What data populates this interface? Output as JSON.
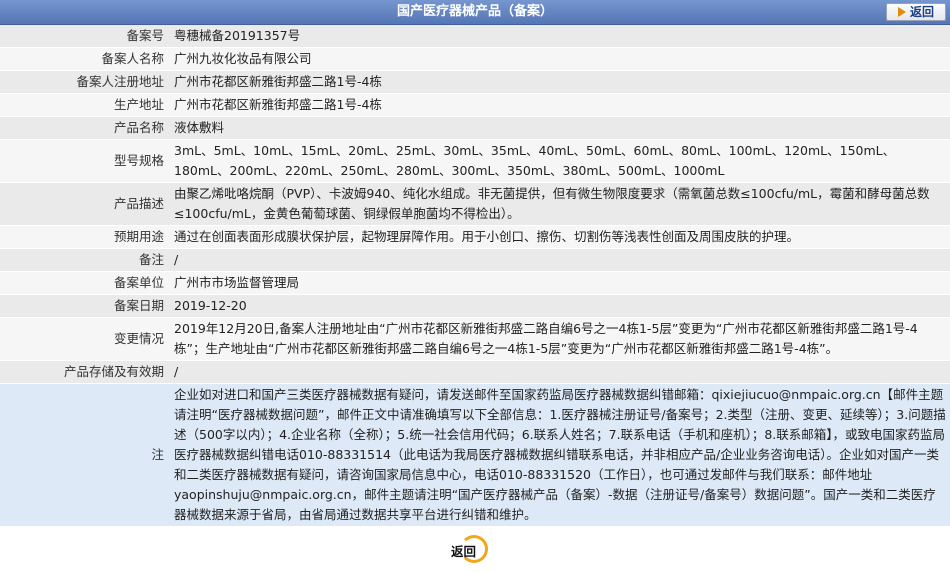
{
  "header": {
    "title": "国产医疗器械产品（备案）",
    "back_label": "返回"
  },
  "rows": [
    {
      "label": "备案号",
      "value": "粤穗械备20191357号"
    },
    {
      "label": "备案人名称",
      "value": "广州九妆化妆品有限公司"
    },
    {
      "label": "备案人注册地址",
      "value": "广州市花都区新雅街邦盛二路1号-4栋"
    },
    {
      "label": "生产地址",
      "value": "广州市花都区新雅街邦盛二路1号-4栋"
    },
    {
      "label": "产品名称",
      "value": "液体敷料"
    },
    {
      "label": "型号规格",
      "value": "3mL、5mL、10mL、15mL、20mL、25mL、30mL、35mL、40mL、50mL、60mL、80mL、100mL、120mL、150mL、180mL、200mL、220mL、250mL、280mL、300mL、350mL、380mL、500mL、1000mL"
    },
    {
      "label": "产品描述",
      "value": "由聚乙烯吡咯烷酮（PVP）、卡波姆940、纯化水组成。非无菌提供，但有微生物限度要求（需氧菌总数≤100cfu/mL，霉菌和酵母菌总数≤100cfu/mL，金黄色葡萄球菌、铜绿假单胞菌均不得检出）。"
    },
    {
      "label": "预期用途",
      "value": "通过在创面表面形成膜状保护层，起物理屏障作用。用于小创口、擦伤、切割伤等浅表性创面及周围皮肤的护理。"
    },
    {
      "label": "备注",
      "value": "/"
    },
    {
      "label": "备案单位",
      "value": "广州市市场监督管理局"
    },
    {
      "label": "备案日期",
      "value": "2019-12-20"
    },
    {
      "label": "变更情况",
      "value": "2019年12月20日,备案人注册地址由“广州市花都区新雅街邦盛二路自编6号之一4栋1-5层”变更为“广州市花都区新雅街邦盛二路1号-4栋”；生产地址由“广州市花都区新雅街邦盛二路自编6号之一4栋1-5层”变更为“广州市花都区新雅街邦盛二路1号-4栋”。"
    },
    {
      "label": "产品存储及有效期",
      "value": "/"
    }
  ],
  "note": {
    "label": "注",
    "text": "企业如对进口和国产三类医疗器械数据有疑问，请发送邮件至国家药监局医疗器械数据纠错邮箱：qixiejiucuo@nmpaic.org.cn【邮件主题请注明“医疗器械数据问题”，邮件正文中请准确填写以下全部信息：1.医疗器械注册证号/备案号；2.类型（注册、变更、延续等）；3.问题描述（500字以内）；4.企业名称（全称）；5.统一社会信用代码；6.联系人姓名；7.联系电话（手机和座机）；8.联系邮箱】，或致电国家药监局医疗器械数据纠错电话010-88331514（此电话为我局医疗器械数据纠错联系电话，并非相应产品/企业业务咨询电话）。企业如对国产一类和二类医疗器械数据有疑问，请咨询国家局信息中心，电话010-88331520（工作日），也可通过发邮件与我们联系：邮件地址yaopinshuju@nmpaic.org.cn，邮件主题请注明“国产医疗器械产品（备案）-数据（注册证号/备案号）数据问题”。国产一类和二类医疗器械数据来源于省局，由省局通过数据共享平台进行纠错和维护。"
  },
  "footer": {
    "back_label": "返回"
  }
}
